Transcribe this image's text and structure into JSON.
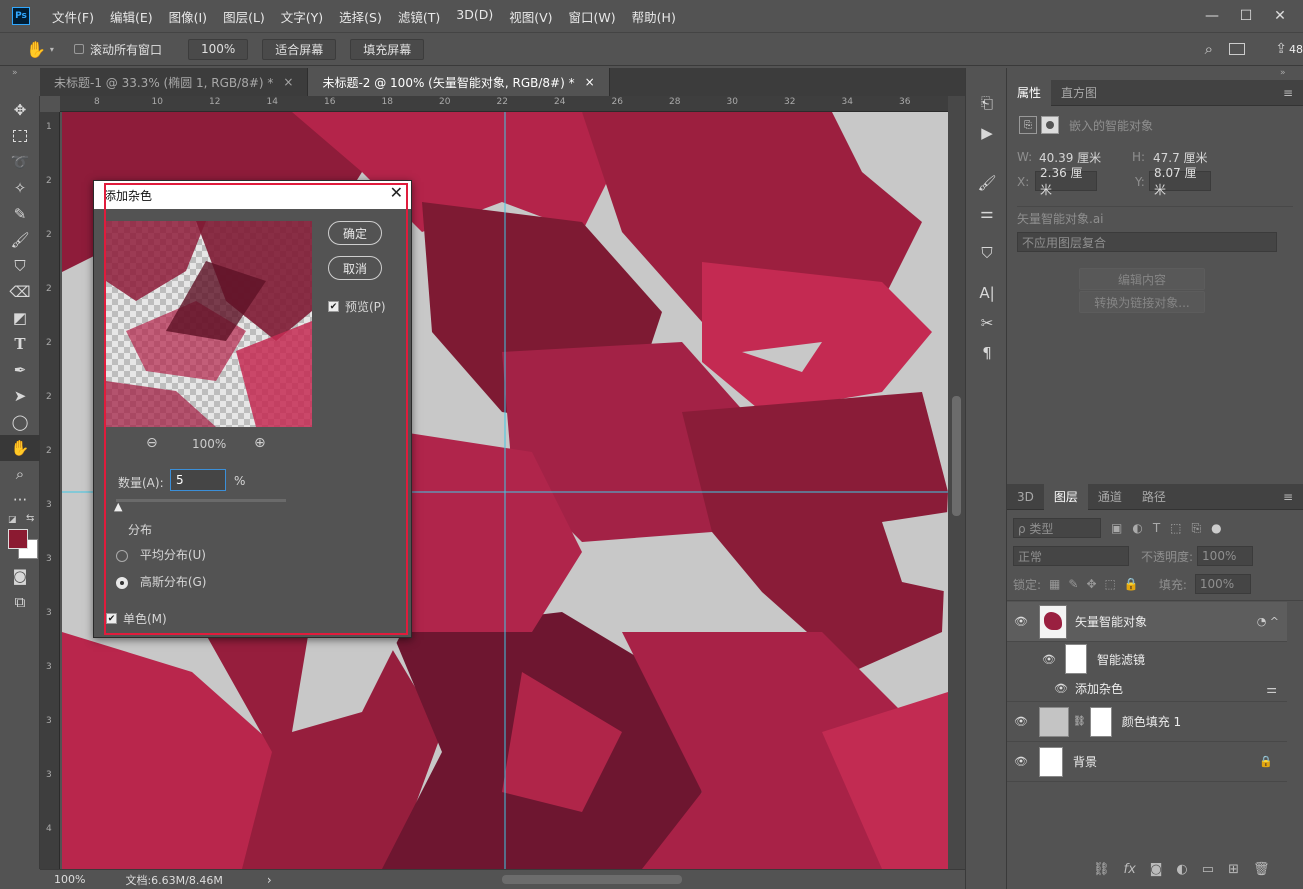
{
  "menubar": {
    "logo": "Ps",
    "items": [
      "文件(F)",
      "编辑(E)",
      "图像(I)",
      "图层(L)",
      "文字(Y)",
      "选择(S)",
      "滤镜(T)",
      "3D(D)",
      "视图(V)",
      "窗口(W)",
      "帮助(H)"
    ],
    "win_min": "—",
    "win_max": "☐",
    "win_close": "✕"
  },
  "options": {
    "scroll_all": "滚动所有窗口",
    "zoom": "100%",
    "fit_screen": "适合屏幕",
    "fill_screen": "填充屏幕",
    "right_num": "48"
  },
  "tabs": [
    {
      "label": "未标题-1 @ 33.3% (椭圆 1, RGB/8#) *",
      "close": "×"
    },
    {
      "label": "未标题-2 @ 100% (矢量智能对象, RGB/8#) *",
      "close": "×"
    }
  ],
  "ruler": {
    "top": [
      "8",
      "10",
      "12",
      "14",
      "16",
      "18",
      "20",
      "22",
      "24",
      "26",
      "28",
      "30",
      "32",
      "34",
      "36"
    ],
    "left": [
      "1",
      "2",
      "2",
      "2",
      "2",
      "2",
      "2",
      "3",
      "3",
      "3",
      "3",
      "3",
      "3",
      "4"
    ]
  },
  "status": {
    "zoom": "100%",
    "doc": "文档:6.63M/8.46M",
    "arrow": "›"
  },
  "dialog": {
    "title": "添加杂色",
    "ok": "确定",
    "cancel": "取消",
    "preview": "预览(P)",
    "zoom": "100%",
    "amount_label": "数量(A):",
    "amount_value": "5",
    "percent": "%",
    "distribution": "分布",
    "uniform": "平均分布(U)",
    "gaussian": "高斯分布(G)",
    "mono": "单色(M)"
  },
  "properties": {
    "tab_props": "属性",
    "tab_hist": "直方图",
    "embedded": "嵌入的智能对象",
    "w_label": "W:",
    "w_value": "40.39 厘米",
    "h_label": "H:",
    "h_value": "47.7 厘米",
    "x_label": "X:",
    "x_value": "2.36 厘米",
    "y_label": "Y:",
    "y_value": "8.07 厘米",
    "smart_label": "矢量智能对象.ai",
    "comp_placeholder": "不应用图层复合",
    "edit_btn": "编辑内容",
    "convert_btn": "转换为链接对象..."
  },
  "layers": {
    "tab_3d": "3D",
    "tab_layers": "图层",
    "tab_channels": "通道",
    "tab_paths": "路径",
    "filter_kind": "ρ 类型",
    "blend": "正常",
    "opacity_label": "不透明度:",
    "opacity_value": "100%",
    "lock_label": "锁定:",
    "fill_label": "填充:",
    "fill_value": "100%",
    "items": [
      {
        "name": "矢量智能对象"
      },
      {
        "name": "智能滤镜"
      },
      {
        "name": "添加杂色"
      },
      {
        "name": "颜色填充 1"
      },
      {
        "name": "背景"
      }
    ]
  },
  "colors": {
    "foreground": "#8b1a31",
    "background": "#ffffff",
    "accent": "#e01c3c",
    "guide": "#3fc7e4"
  }
}
